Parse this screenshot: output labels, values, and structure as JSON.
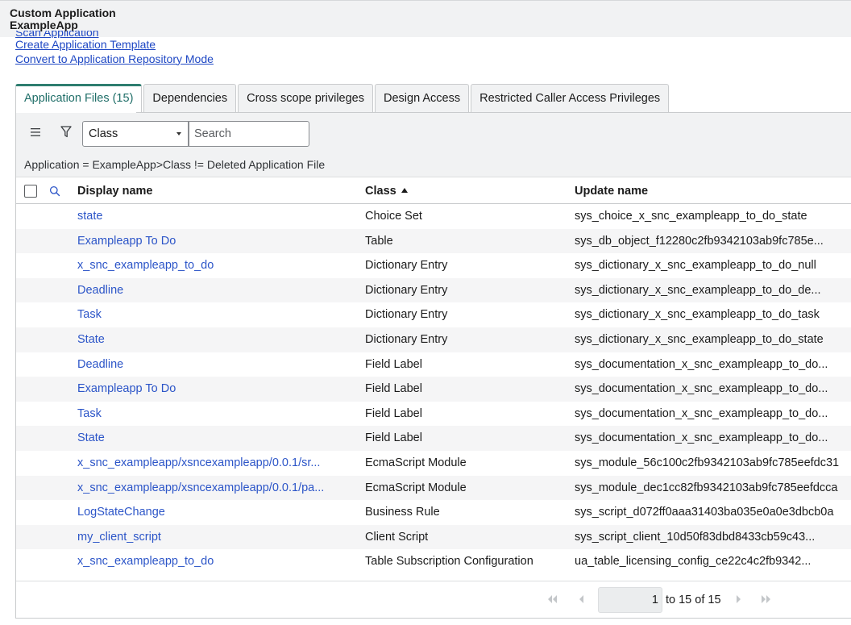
{
  "header": {
    "line1": "Custom Application",
    "line2": "ExampleApp"
  },
  "links": [
    "Scan Application",
    "Create Application Template",
    "Convert to Application Repository Mode"
  ],
  "tabs": [
    "Application Files (15)",
    "Dependencies",
    "Cross scope privileges",
    "Design Access",
    "Restricted Caller Access Privileges"
  ],
  "toolbar": {
    "select_value": "Class",
    "search_placeholder": "Search"
  },
  "breadcrumb": "Application = ExampleApp>Class != Deleted Application File",
  "columns": [
    "Display name",
    "Class",
    "Update name"
  ],
  "sort": {
    "column": "Class",
    "direction": "ascending"
  },
  "rows": [
    [
      "state",
      "Choice Set",
      "sys_choice_x_snc_exampleapp_to_do_state"
    ],
    [
      "Exampleapp To Do",
      "Table",
      "sys_db_object_f12280c2fb9342103ab9fc785e..."
    ],
    [
      "x_snc_exampleapp_to_do",
      "Dictionary Entry",
      "sys_dictionary_x_snc_exampleapp_to_do_null"
    ],
    [
      "Deadline",
      "Dictionary Entry",
      "sys_dictionary_x_snc_exampleapp_to_do_de..."
    ],
    [
      "Task",
      "Dictionary Entry",
      "sys_dictionary_x_snc_exampleapp_to_do_task"
    ],
    [
      "State",
      "Dictionary Entry",
      "sys_dictionary_x_snc_exampleapp_to_do_state"
    ],
    [
      "Deadline",
      "Field Label",
      "sys_documentation_x_snc_exampleapp_to_do..."
    ],
    [
      "Exampleapp To Do",
      "Field Label",
      "sys_documentation_x_snc_exampleapp_to_do..."
    ],
    [
      "Task",
      "Field Label",
      "sys_documentation_x_snc_exampleapp_to_do..."
    ],
    [
      "State",
      "Field Label",
      "sys_documentation_x_snc_exampleapp_to_do..."
    ],
    [
      "x_snc_exampleapp/xsncexampleapp/0.0.1/sr...",
      "EcmaScript Module",
      "sys_module_56c100c2fb9342103ab9fc785eefdc31"
    ],
    [
      "x_snc_exampleapp/xsncexampleapp/0.0.1/pa...",
      "EcmaScript Module",
      "sys_module_dec1cc82fb9342103ab9fc785eefdcca"
    ],
    [
      "LogStateChange",
      "Business Rule",
      "sys_script_d072ff0aaa31403ba035e0a0e3dbcb0a"
    ],
    [
      "my_client_script",
      "Client Script",
      "sys_script_client_10d50f83dbd8433cb59c43..."
    ],
    [
      "x_snc_exampleapp_to_do",
      "Table Subscription Configuration",
      "ua_table_licensing_config_ce22c4c2fb9342..."
    ]
  ],
  "pagination": {
    "current": "1",
    "label": "to 15 of 15"
  },
  "colors": {
    "link": "#2c55c8",
    "active_tab_accent": "#2e7d6f",
    "toolbar_bg": "#f1f2f3"
  }
}
